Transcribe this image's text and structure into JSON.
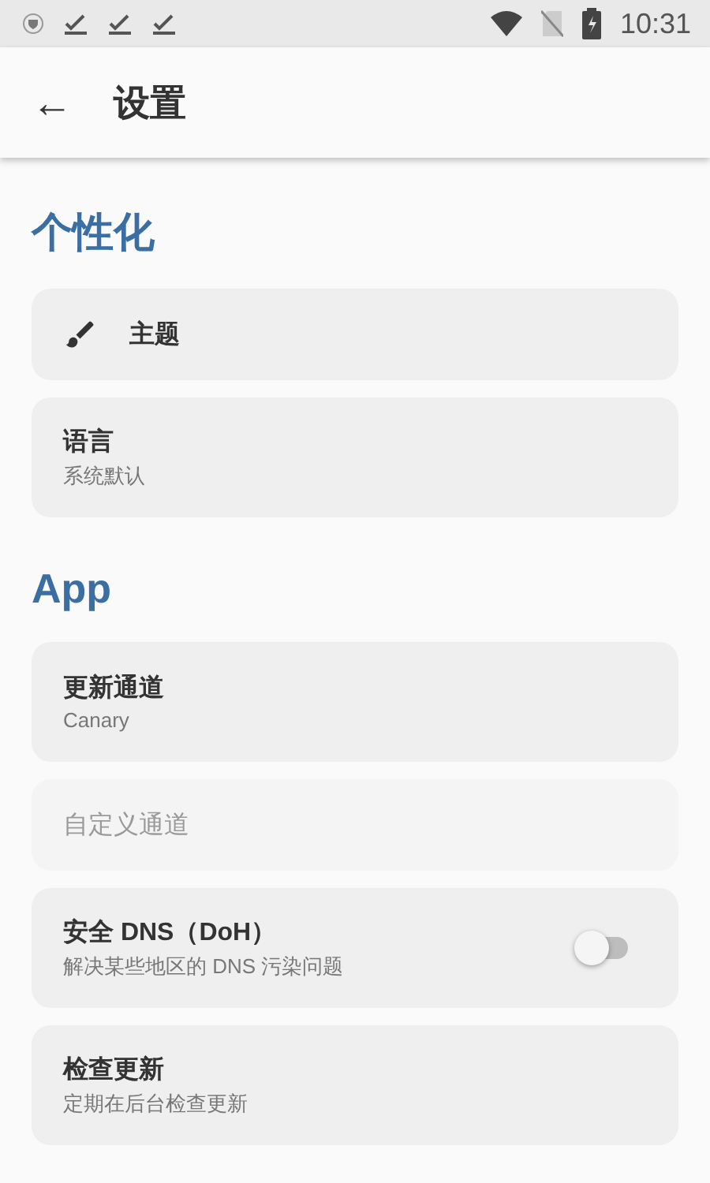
{
  "status_bar": {
    "time": "10:31"
  },
  "app_bar": {
    "back": "←",
    "title": "设置"
  },
  "sections": [
    {
      "title": "个性化",
      "items": [
        {
          "kind": "icon",
          "title": "主题",
          "disabled": false
        },
        {
          "kind": "text",
          "title": "语言",
          "summary": "系统默认",
          "disabled": false
        }
      ]
    },
    {
      "title": "App",
      "items": [
        {
          "kind": "text",
          "title": "更新通道",
          "summary": "Canary",
          "disabled": false
        },
        {
          "kind": "text",
          "title": "自定义通道",
          "disabled": true
        },
        {
          "kind": "switch",
          "title": "安全 DNS（DoH）",
          "summary": "解决某些地区的 DNS 污染问题",
          "on": false,
          "disabled": false
        },
        {
          "kind": "text",
          "title": "检查更新",
          "summary": "定期在后台检查更新",
          "disabled": false
        }
      ]
    }
  ]
}
